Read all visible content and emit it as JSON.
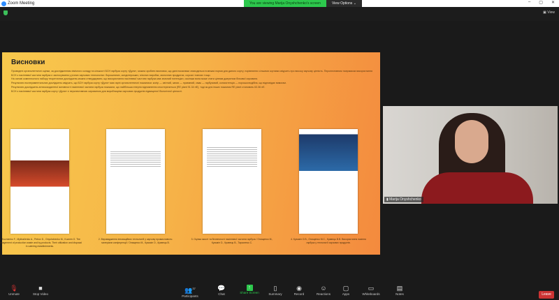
{
  "window": {
    "title": "Zoom Meeting",
    "controls": [
      "–",
      "▢",
      "✕"
    ]
  },
  "banner": {
    "viewing": "You are viewing Marija Onyshchenko's screen",
    "view_options": "View Options ⌄"
  },
  "topbar": {
    "view_label": "View"
  },
  "slide": {
    "title": "Висновки",
    "paragraphs": [
      "Проведені органолептичні оцінки, за дослідженням хімічного складу та кількості БСН гарбуза сорту «Дуля», можна зробити висновок, що дані показники знаходяться в межах норми для даного сорту; порівняння з іншими сортами свідчить про високу харчову цінність. Перспективним напрямком використання БСН з насіннєвої частини гарбуза є застосування у різних харчових технологіях: борошняних, кондитерських, м'ясних виробах, молочних продуктах, соусах і напоях тощо.",
      "На основі комплексного набору теоретичних досліджень можна стверджувати, що використання насіннєвої частини гарбуза має значний потенціал, оскільки вона може стати цінним джерелом білкової сировини.",
      "Результати експериментальних досліджень свідчать, що БСН гарбуза сорту «Дуля» має гарні органолептичні показники: колір — світлий, запах — приємний, смак — гарбузовий, консистенція — порошкоподібна, що відповідає вимогам.",
      "Результати досліджень антиоксидантної активності насіннєвої частини гарбуза показали, що найбільша енергія відновлення спостерігається (RE plant 91.34 нЕ), тоді як для інших показник RE plant становить 63.36 нЕ.",
      "БСН з насіннєвої частини гарбуза сорту «Дуля» є перспективною сировиною для виробництва харчових продуктів підвищеної біологічної цінності."
    ],
    "references": [
      "1. Kuzmenko F., Mykhailenko A., Petrov D., Onyshchenko M., Kuzmin O. The management of production waste and by-products. Their utilization and disposal in catering establishments.",
      "2. Впровадження інноваційних технологій у харчову промисловість: матеріали конференції / Онищенко М., Кузьмін О., Кравець В.",
      "3. Оцінка якості та безпечності насіннєвої частини гарбуза / Онищенко М., Кузьмін О., Кравець В., Тарасенко С.",
      "4. Кузьмін О.В., Онищенко М.С., Кравець В.В. Використання насіння гарбуза у технології харчових продуктів."
    ]
  },
  "video": {
    "participant_name": "Marija Onyshchenko"
  },
  "toolbar": {
    "unmute": "Unmute",
    "stop_video": "Stop Video",
    "participants": "Participants",
    "participants_count": "37",
    "chat": "Chat",
    "share_screen": "Share Screen",
    "summary": "Summary",
    "record": "Record",
    "reactions": "Reactions",
    "apps": "Apps",
    "whiteboards": "Whiteboards",
    "notes": "Notes",
    "leave": "Leave"
  },
  "colors": {
    "share_green": "#2dc84d",
    "leave_red": "#cc3333",
    "banner_green": "#2dc84d"
  }
}
